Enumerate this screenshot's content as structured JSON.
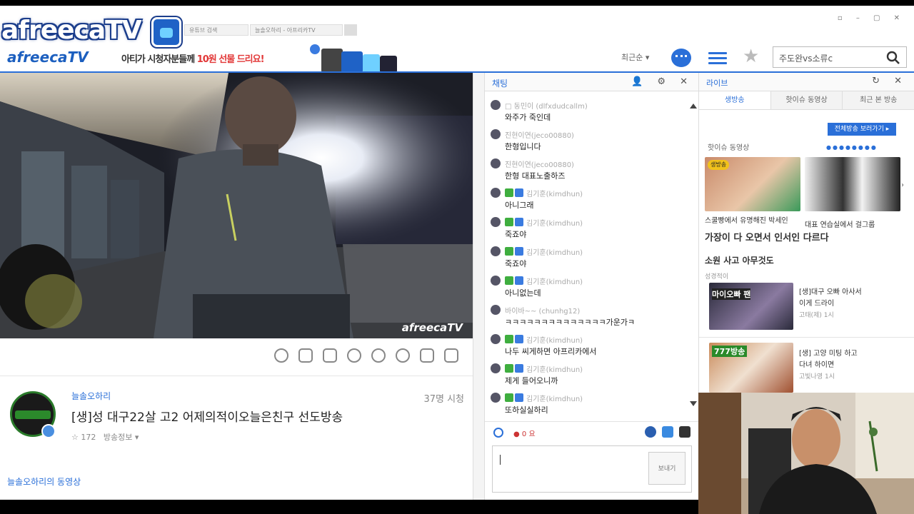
{
  "header": {
    "browser_tabs": [
      "유튜브 검색",
      "늘솔오하리 - 아프리카TV"
    ],
    "window_controls": "▫ – ▢ ✕",
    "brand": "afreecaTV",
    "brand_small": "afreecaTV",
    "promo_text": "아티가 시청자분들께 ",
    "promo_highlight": "10원 선물 드리요!",
    "sort_label": "최근순 ▾",
    "search_value": "주도완vs소류c"
  },
  "video": {
    "watermark": "afreecaTV"
  },
  "broadcast": {
    "bj_name": "늘솔오하리",
    "viewers": "37명 시청",
    "title": "[생]성 대구22살 고2 어제의적이오늘은친구 선도방송",
    "favorites": "☆ 172",
    "favorites_extra": "방송정보 ▾",
    "vod_link": "늘솔오하리의 동영상"
  },
  "chat": {
    "title": "채팅",
    "head_icons": "👤 ⚙ ✕",
    "messages": [
      {
        "nick": "□ 동민이 (dlfxdudcallm)",
        "text": "와주가 죽인데",
        "badges": false
      },
      {
        "nick": "진현이연(jeco00880)",
        "text": "한형입니다",
        "badges": false
      },
      {
        "nick": "진현이연(jeco00880)",
        "text": "한형 대표노출하즈",
        "badges": false
      },
      {
        "nick": "김기훈(kimdhun)",
        "text": "아니그래",
        "badges": true
      },
      {
        "nick": "김기훈(kimdhun)",
        "text": "죽죠야",
        "badges": true
      },
      {
        "nick": "김기훈(kimdhun)",
        "text": "죽죠야",
        "badges": true
      },
      {
        "nick": "김기훈(kimdhun)",
        "text": "아니없는데",
        "badges": true
      },
      {
        "nick": "바이바~~ (chunhg12)",
        "text": "ㅋㅋㅋㅋㅋㅋㅋㅋㅋㅋㅋㅋㅋㅋ가운가ㅋ",
        "badges": false
      },
      {
        "nick": "김기훈(kimdhun)",
        "text": "나두 씨게하면 아프리카에서",
        "badges": true
      },
      {
        "nick": "김기훈(kimdhun)",
        "text": "제게 들어오니까",
        "badges": true
      },
      {
        "nick": "김기훈(kimdhun)",
        "text": "또하실실하리",
        "badges": true
      }
    ],
    "tool_label": "● 0 요",
    "send_label": "보내기"
  },
  "right_panel": {
    "title": "라이브",
    "head_icons": "↻ ✕",
    "tabs": [
      "생방송",
      "핫이슈 동영상",
      "최근 본 방송"
    ],
    "button": "전체방송 보러가기 ▸",
    "section_title": "핫이슈 동영상",
    "dots": "●●●●●●●●",
    "captions": [
      "생방송",
      "스쿨빵에서 유명해진 박세인",
      "가장이 다 오면서 인서인 다르다",
      "대표 연습실에서 걸그룹",
      "소원 사고 아무것도",
      "성경적이",
      "[생]대구 오빠 아사서",
      "이게 드라이",
      "고태(제) 1시",
      "[생] 고양 미팅 하고",
      "다녀 하이면",
      "고빛나영 1시"
    ],
    "thumb_labels": [
      "생방송",
      "마이오빠 팬",
      "777방송"
    ]
  },
  "colors": {
    "accent": "#2a6fd8",
    "promo_red": "#e23838",
    "brand_navy": "#1c3e8c"
  }
}
